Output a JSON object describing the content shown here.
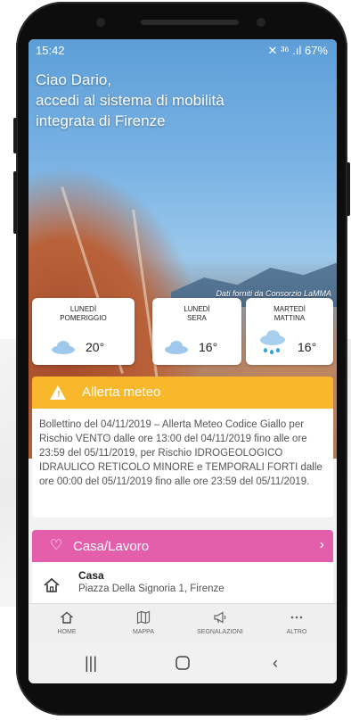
{
  "status_bar": {
    "time": "15:42",
    "indicators": "✕ ³⁶ .ıl 67%"
  },
  "greeting": {
    "line1": "Ciao Dario,",
    "line2": "accedi al sistema di mobilità",
    "line3": "integrata di Firenze"
  },
  "credits": "Dati forniti da Consorzio LaMMA",
  "weather": [
    {
      "day": "LUNEDÌ",
      "period": "POMERIGGIO",
      "temp": "20°",
      "icon": "cloud-icon"
    },
    {
      "day": "LUNEDÌ",
      "period": "SERA",
      "temp": "16°",
      "icon": "cloud-icon"
    },
    {
      "day": "MARTEDÌ",
      "period": "MATTINA",
      "temp": "16°",
      "icon": "rain-icon"
    }
  ],
  "alert": {
    "title": "Allerta meteo",
    "text": "Bollettino del 04/11/2019 – Allerta Meteo Codice Giallo per Rischio VENTO dalle ore 13:00 del 04/11/2019 fino alle ore 23:59 del 05/11/2019, per Rischio IDROGEOLOGICO IDRAULICO RETICOLO MINORE e TEMPORALI FORTI dalle ore 00:00 del 05/11/2019 fino alle ore 23:59 del 05/11/2019."
  },
  "casa_lavoro": {
    "title": "Casa/Lavoro",
    "item_name": "Casa",
    "item_address": "Piazza Della Signoria 1, Firenze"
  },
  "bottom_nav": [
    {
      "label": "HOME",
      "icon": "home-icon"
    },
    {
      "label": "MAPPA",
      "icon": "map-icon"
    },
    {
      "label": "SEGNALAZIONI",
      "icon": "megaphone-icon"
    },
    {
      "label": "ALTRO",
      "icon": "more-icon"
    }
  ],
  "colors": {
    "alert": "#f9b72c",
    "casa": "#e35fac",
    "weather_icon": "#9ec8ec"
  }
}
